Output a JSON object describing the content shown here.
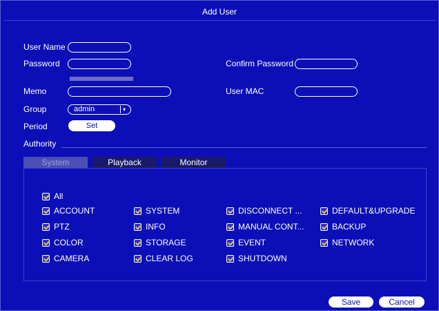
{
  "dialog": {
    "title": "Add User"
  },
  "form": {
    "user_name_label": "User Name",
    "password_label": "Password",
    "confirm_password_label": "Confirm Password",
    "memo_label": "Memo",
    "user_mac_label": "User MAC",
    "group_label": "Group",
    "group_value": "admin",
    "period_label": "Period",
    "set_label": "Set",
    "authority_label": "Authority"
  },
  "tabs": [
    {
      "label": "System",
      "active": true
    },
    {
      "label": "Playback",
      "active": false
    },
    {
      "label": "Monitor",
      "active": false
    }
  ],
  "permissions": {
    "all": {
      "label": "All",
      "checked": true
    },
    "col1": [
      "ACCOUNT",
      "PTZ",
      "COLOR",
      "CAMERA"
    ],
    "col2": [
      "SYSTEM",
      "INFO",
      "STORAGE",
      "CLEAR LOG"
    ],
    "col3": [
      "DISCONNECT ...",
      "MANUAL CONT...",
      "EVENT",
      "SHUTDOWN"
    ],
    "col4": [
      "DEFAULT&UPGRADE",
      "BACKUP",
      "NETWORK"
    ]
  },
  "actions": {
    "save_label": "Save",
    "cancel_label": "Cancel"
  },
  "colors": {
    "background": "#0c0fb7",
    "check": "#e6c24a"
  }
}
